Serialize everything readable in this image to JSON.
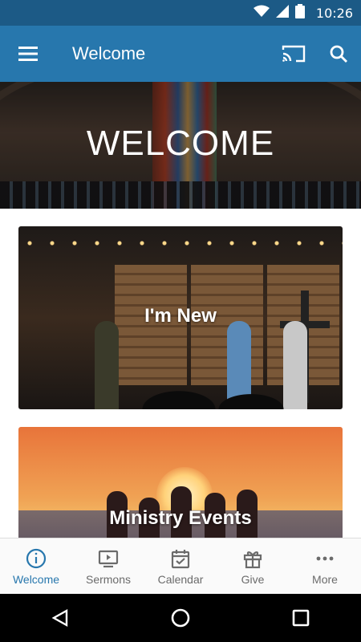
{
  "status_bar": {
    "time": "10:26",
    "wifi_icon": "wifi-icon",
    "battery_icon": "battery-icon"
  },
  "app_bar": {
    "title": "Welcome",
    "menu_icon": "menu-icon",
    "cast_icon": "cast-icon",
    "search_icon": "search-icon",
    "color": "#2777ad"
  },
  "hero": {
    "title": "WELCOME"
  },
  "cards": [
    {
      "label": "I'm New"
    },
    {
      "label": "Ministry Events"
    }
  ],
  "bottom_nav": {
    "items": [
      {
        "label": "Welcome",
        "icon": "info-icon",
        "active": true
      },
      {
        "label": "Sermons",
        "icon": "video-icon",
        "active": false
      },
      {
        "label": "Calendar",
        "icon": "calendar-icon",
        "active": false
      },
      {
        "label": "Give",
        "icon": "gift-icon",
        "active": false
      },
      {
        "label": "More",
        "icon": "more-icon",
        "active": false
      }
    ]
  },
  "system_nav": {
    "back_icon": "back-icon",
    "home_icon": "home-icon",
    "recents_icon": "recents-icon"
  }
}
